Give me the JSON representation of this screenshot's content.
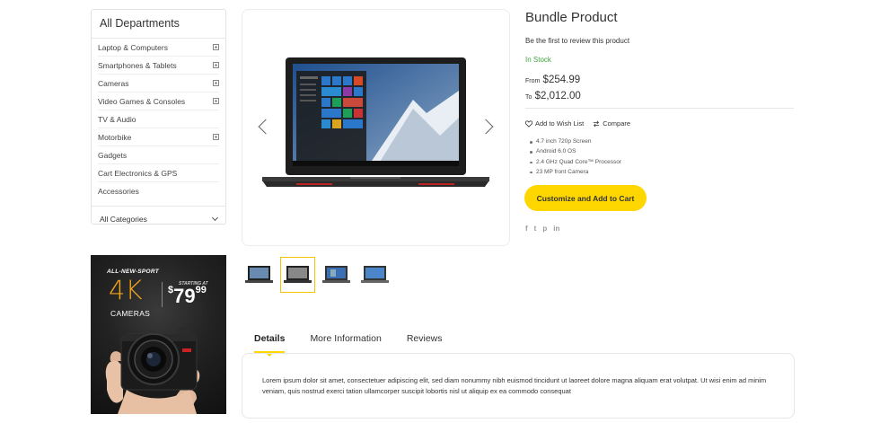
{
  "sidebar": {
    "title": "All Departments",
    "items": [
      {
        "label": "Laptop & Computers",
        "expandable": true
      },
      {
        "label": "Smartphones & Tablets",
        "expandable": true
      },
      {
        "label": "Cameras",
        "expandable": true
      },
      {
        "label": "Video Games & Consoles",
        "expandable": true
      },
      {
        "label": "TV & Audio",
        "expandable": false
      },
      {
        "label": "Motorbike",
        "expandable": true
      },
      {
        "label": "Gadgets",
        "expandable": false
      },
      {
        "label": "Cart Electronics & GPS",
        "expandable": false
      },
      {
        "label": "Accessories",
        "expandable": false
      }
    ],
    "all_categories": "All Categories"
  },
  "promo": {
    "tagline": "ALL-NEW-SPORT",
    "headline": "4K",
    "subhead": "CAMERAS",
    "starting_label": "STARTING AT",
    "price_dollar": "$",
    "price_whole": "79",
    "price_cents": "99"
  },
  "product": {
    "title": "Bundle Product",
    "review_link": "Be the first to review this product",
    "stock": "In Stock",
    "price_from_label": "From",
    "price_from": "$254.99",
    "price_to_label": "To",
    "price_to": "$2,012.00",
    "wishlist_label": "Add to Wish List",
    "compare_label": "Compare",
    "features": [
      "4.7 inch 720p Screen",
      "Android 6.0 OS",
      "2.4 GHz Quad Core™ Processor",
      "23 MP front Camera"
    ],
    "cta_label": "Customize and Add to Cart",
    "social": [
      "f",
      "t",
      "p",
      "in"
    ]
  },
  "gallery": {
    "thumbnail_count": 4,
    "active_thumbnail": 1
  },
  "tabs": {
    "items": [
      "Details",
      "More Information",
      "Reviews"
    ],
    "active": "Details",
    "details_text": "Lorem ipsum dolor sit amet, consectetuer adipiscing elit, sed diam nonummy nibh euismod tincidunt ut laoreet dolore magna aliquam erat volutpat. Ut wisi enim ad minim veniam, quis nostrud exerci tation ullamcorper suscipit lobortis nisl ut aliquip ex ea commodo consequat"
  },
  "colors": {
    "accent": "#fed700",
    "in_stock": "#3da33d",
    "promo_orange": "#f0a41c"
  }
}
